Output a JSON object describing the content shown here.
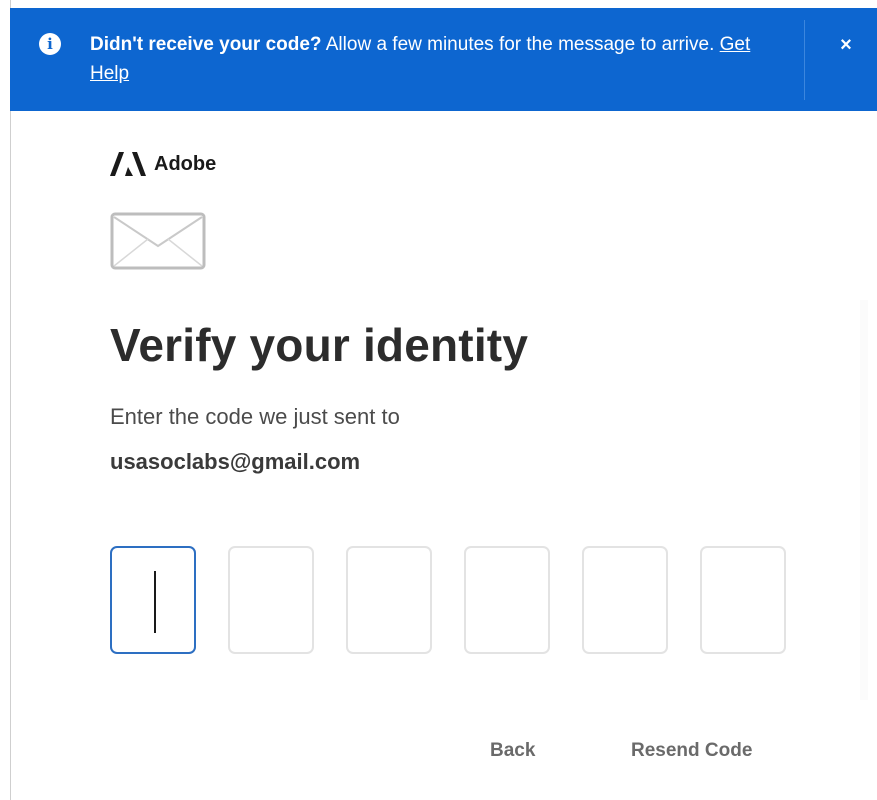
{
  "banner": {
    "bold_text": "Didn't receive your code?",
    "text": " Allow a few minutes for the message to arrive. ",
    "link_label": "Get Help",
    "close_label": "×",
    "info_glyph": "i",
    "info_icon": "info-icon",
    "background_color": "#0d66d0"
  },
  "logo": {
    "text": "Adobe"
  },
  "main": {
    "title": "Verify your identity",
    "subtitle": "Enter the code we just sent to",
    "email": "usasoclabs@gmail.com"
  },
  "code_inputs": [
    {
      "value": "",
      "focused": true
    },
    {
      "value": "",
      "focused": false
    },
    {
      "value": "",
      "focused": false
    },
    {
      "value": "",
      "focused": false
    },
    {
      "value": "",
      "focused": false
    },
    {
      "value": "",
      "focused": false
    }
  ],
  "actions": {
    "back_label": "Back",
    "resend_label": "Resend Code"
  }
}
